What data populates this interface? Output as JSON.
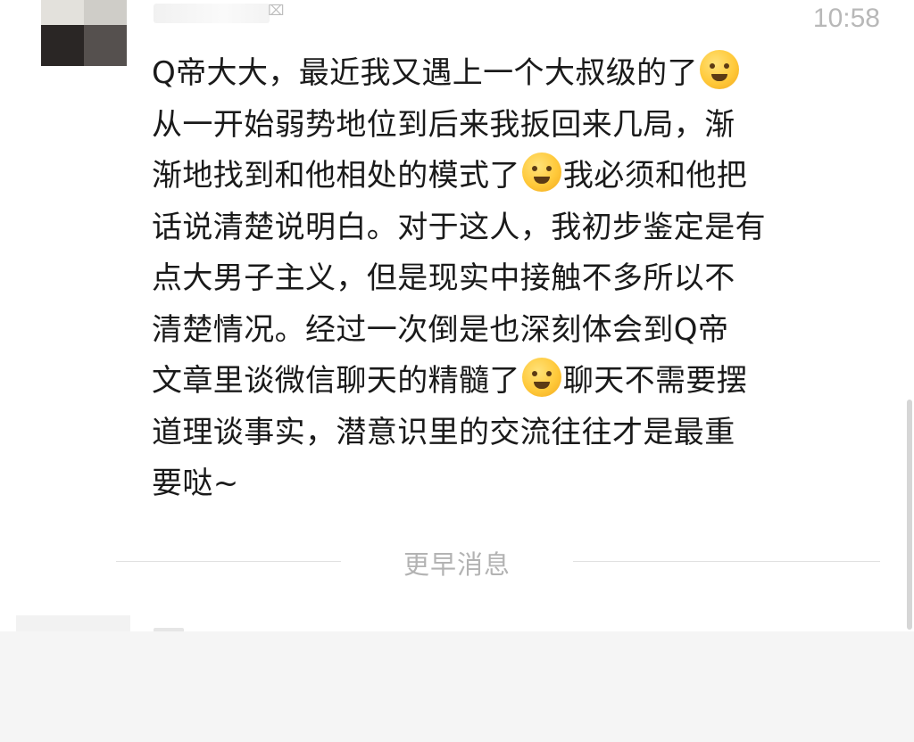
{
  "chat": {
    "timestamp": "10:58",
    "name_mark": "⌧",
    "message": {
      "lines": [
        [
          "Q帝大大，最近我又遇上一个大叔级的了",
          "emoji:cry-laugh",
          ""
        ],
        [
          "从一开始弱势地位到后来我扳回来几局，渐",
          "",
          ""
        ],
        [
          "渐地找到和他相处的模式了",
          "emoji:hug",
          "我必须和他把"
        ],
        [
          "话说清楚说明白。对于这人，我初步鉴定是有",
          "",
          ""
        ],
        [
          "点大男子主义，但是现实中接触不多所以不",
          "",
          ""
        ],
        [
          "清楚情况。经过一次倒是也深刻体会到Q帝",
          "",
          ""
        ],
        [
          "文章里谈微信聊天的精髓了",
          "emoji:smirk",
          "聊天不需要摆"
        ],
        [
          "道理谈事实，潜意识里的交流往往才是最重",
          "",
          ""
        ],
        [
          "要哒~",
          "",
          ""
        ]
      ]
    },
    "divider_text": "更早消息"
  },
  "colors": {
    "background": "#ffffff",
    "text": "#1a1a1a",
    "timestamp": "#b8b8b8",
    "divider": "#b3b3b3",
    "input_area": "#f5f5f5"
  }
}
